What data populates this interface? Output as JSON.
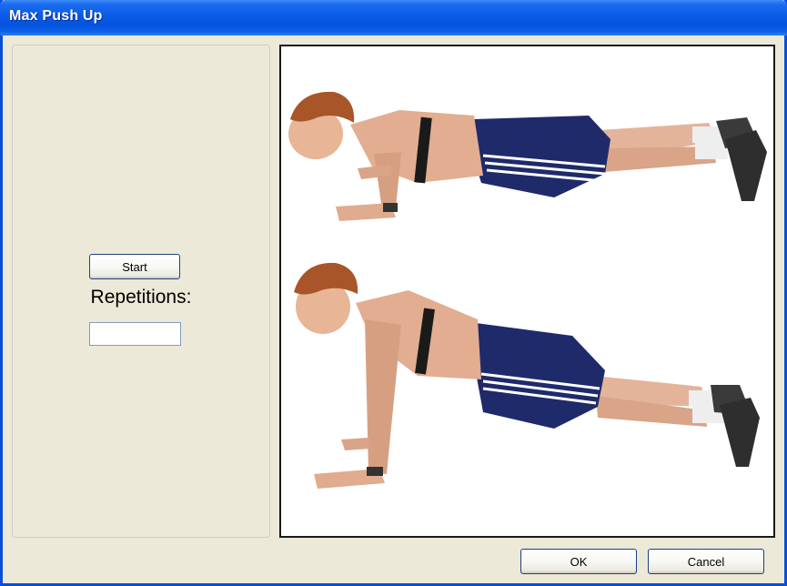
{
  "window": {
    "title": "Max Push Up"
  },
  "left_panel": {
    "start_label": "Start",
    "repetitions_label": "Repetitions:",
    "repetitions_value": ""
  },
  "footer": {
    "ok_label": "OK",
    "cancel_label": "Cancel"
  },
  "colors": {
    "titlebar": "#0a5be6",
    "window_bg": "#ece9d8",
    "button_border": "#1f3f87"
  }
}
